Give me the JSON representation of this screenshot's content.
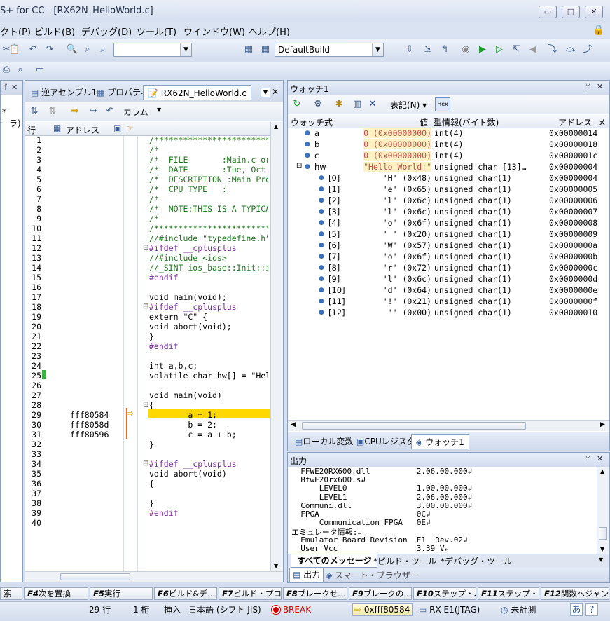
{
  "window": {
    "title": "S+ for CC - [RX62N_HelloWorld.c]",
    "buttons": [
      "▭",
      "□",
      "✕"
    ]
  },
  "menu": [
    "クト(P)",
    "ビルド(B)",
    "デバッグ(D)",
    "ツール(T)",
    "ウインドウ(W)",
    "ヘルプ(H)"
  ],
  "toolbar": {
    "build_config": "DefaultBuild"
  },
  "left_panel": {
    "close": "✕",
    "pin": "ᛘ",
    "item1": "*",
    "item2": "ーラ)"
  },
  "editor": {
    "tabs": [
      "逆アセンブル1",
      "プロパティ",
      "RX62N_HelloWorld.c"
    ],
    "toolbar_column": "カラム",
    "col_line": "行",
    "col_address": "アドレス",
    "line_numbers": [
      "1",
      "2",
      "3",
      "4",
      "5",
      "6",
      "7",
      "8",
      "9",
      "10",
      "11",
      "12",
      "13",
      "14",
      "15",
      "16",
      "17",
      "18",
      "19",
      "20",
      "21",
      "22",
      "23",
      "24",
      "25",
      "26",
      "27",
      "28",
      "29",
      "30",
      "31",
      "32",
      "33",
      "34",
      "35",
      "36",
      "37",
      "38",
      "39",
      "40"
    ],
    "code": [
      "/***************************",
      "/*",
      "/*  FILE       :Main.c or",
      "/*  DATE       :Tue, Oct 3",
      "/*  DESCRIPTION :Main Progr",
      "/*  CPU TYPE   :",
      "/*",
      "/*  NOTE:THIS IS A TYPICAL",
      "/*",
      "/***************************",
      "//#include \"typedefine.h\"",
      "#ifdef __cplusplus",
      "//#include <ios>",
      "//_SINT ios_base::Init::ini",
      "#endif",
      "",
      "void main(void);",
      "#ifdef __cplusplus",
      "extern \"C\" {",
      "void abort(void);",
      "}",
      "#endif",
      "",
      "int a,b,c;",
      "volatile char hw[] = \"Hello",
      "",
      "void main(void)",
      "{",
      "        a = 1;",
      "        b = 2;",
      "        c = a + b;",
      "}",
      "",
      "#ifdef __cplusplus",
      "void abort(void)",
      "{",
      "",
      "}",
      "#endif",
      ""
    ],
    "addresses": [
      {
        "line": 29,
        "addr": "fff80584"
      },
      {
        "line": 30,
        "addr": "fff8058d"
      },
      {
        "line": 31,
        "addr": "fff80596"
      }
    ],
    "current_line": 29
  },
  "watch": {
    "title": "ウォッチ1",
    "notation": "表記(N)",
    "hex": "Hex",
    "columns": [
      "ウォッチ式",
      "値",
      "型情報(バイト数)",
      "アドレス",
      "メ"
    ],
    "rows": [
      {
        "name": "a",
        "value": "0 (0x00000000)",
        "type": "int(4)",
        "addr": "0x00000014",
        "indent": 0,
        "changed": true
      },
      {
        "name": "b",
        "value": "0 (0x00000000)",
        "type": "int(4)",
        "addr": "0x00000018",
        "indent": 0,
        "changed": true
      },
      {
        "name": "c",
        "value": "0 (0x00000000)",
        "type": "int(4)",
        "addr": "0x0000001c",
        "indent": 0,
        "changed": true
      },
      {
        "name": "hw",
        "value": "\"Hello World!\"",
        "type": "unsigned char [13]…",
        "addr": "0x00000004",
        "indent": 0,
        "changed": true,
        "expanded": true
      },
      {
        "name": "[0]",
        "value": "'H' (0x48)",
        "type": "unsigned char(1)",
        "addr": "0x00000004",
        "indent": 1
      },
      {
        "name": "[1]",
        "value": "'e' (0x65)",
        "type": "unsigned char(1)",
        "addr": "0x00000005",
        "indent": 1
      },
      {
        "name": "[2]",
        "value": "'l' (0x6c)",
        "type": "unsigned char(1)",
        "addr": "0x00000006",
        "indent": 1
      },
      {
        "name": "[3]",
        "value": "'l' (0x6c)",
        "type": "unsigned char(1)",
        "addr": "0x00000007",
        "indent": 1
      },
      {
        "name": "[4]",
        "value": "'o' (0x6f)",
        "type": "unsigned char(1)",
        "addr": "0x00000008",
        "indent": 1
      },
      {
        "name": "[5]",
        "value": "' ' (0x20)",
        "type": "unsigned char(1)",
        "addr": "0x00000009",
        "indent": 1
      },
      {
        "name": "[6]",
        "value": "'W' (0x57)",
        "type": "unsigned char(1)",
        "addr": "0x0000000a",
        "indent": 1
      },
      {
        "name": "[7]",
        "value": "'o' (0x6f)",
        "type": "unsigned char(1)",
        "addr": "0x0000000b",
        "indent": 1
      },
      {
        "name": "[8]",
        "value": "'r' (0x72)",
        "type": "unsigned char(1)",
        "addr": "0x0000000c",
        "indent": 1
      },
      {
        "name": "[9]",
        "value": "'l' (0x6c)",
        "type": "unsigned char(1)",
        "addr": "0x0000000d",
        "indent": 1
      },
      {
        "name": "[10]",
        "value": "'d' (0x64)",
        "type": "unsigned char(1)",
        "addr": "0x0000000e",
        "indent": 1
      },
      {
        "name": "[11]",
        "value": "'!' (0x21)",
        "type": "unsigned char(1)",
        "addr": "0x0000000f",
        "indent": 1
      },
      {
        "name": "[12]",
        "value": "'' (0x00)",
        "type": "unsigned char(1)",
        "addr": "0x00000010",
        "indent": 1
      }
    ],
    "bottom_tabs": [
      "ローカル変数",
      "CPUレジスタ",
      "ウォッチ1"
    ]
  },
  "output": {
    "title": "出力",
    "lines": [
      "  FFWE20RX600.dll          2.06.00.000↲",
      "  BfwE20rx600.s↲",
      "      LEVEL0               1.00.00.000↲",
      "      LEVEL1               2.06.00.000↲",
      "  Communi.dll              3.00.00.000↲",
      "  FPGA                     0C↲",
      "      Communication FPGA   0E↲",
      "エミュレータ情報:↲",
      "  Emulator Board Revision  E1  Rev.02↲",
      "  User Vcc                 3.39 V↲"
    ],
    "tabs": [
      "すべてのメッセージ",
      "*ビルド・ツール",
      "*デバッグ・ツール"
    ],
    "bottom_tabs": [
      "出力",
      "スマート・ブラウザー"
    ]
  },
  "fkeys": [
    {
      "key": "",
      "label": "索"
    },
    {
      "key": "F4",
      "label": "次を置換"
    },
    {
      "key": "F5",
      "label": "実行"
    },
    {
      "key": "F6",
      "label": "ビルド&デ…"
    },
    {
      "key": "F7",
      "label": "ビルド・プロ…"
    },
    {
      "key": "F8",
      "label": "ブレークせ…"
    },
    {
      "key": "F9",
      "label": "ブレークの…"
    },
    {
      "key": "F10",
      "label": "ステップ・オ…"
    },
    {
      "key": "F11",
      "label": "ステップ・イン"
    },
    {
      "key": "F12",
      "label": "関数へジャンプ"
    }
  ],
  "status": {
    "line": "29 行",
    "col": "1 桁",
    "mode": "挿入",
    "encoding": "日本語 (シフト JIS)",
    "break": "BREAK",
    "pc": "0xfff80584",
    "target": "RX E1(JTAG)",
    "measure": "未計測"
  },
  "colors": {
    "changed": "#c0504d",
    "highlight": "#ffd800",
    "accent": "#3b5f9a"
  }
}
